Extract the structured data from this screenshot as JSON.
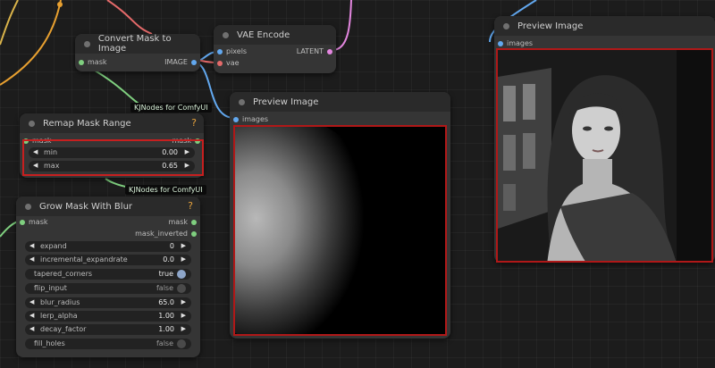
{
  "nodes": {
    "convert_mask": {
      "title": "Convert Mask to Image",
      "input": "mask",
      "output": "IMAGE"
    },
    "vae_encode": {
      "title": "VAE Encode",
      "inputs": [
        "pixels",
        "vae"
      ],
      "output": "LATENT"
    },
    "preview_mid": {
      "title": "Preview Image",
      "input": "images"
    },
    "preview_right": {
      "title": "Preview Image",
      "input": "images"
    },
    "remap_mask": {
      "title": "Remap Mask Range",
      "input": "mask",
      "output": "mask",
      "widgets": [
        {
          "label": "min",
          "value": "0.00"
        },
        {
          "label": "max",
          "value": "0.65"
        }
      ]
    },
    "grow_mask": {
      "title": "Grow Mask With Blur",
      "input": "mask",
      "outputs": [
        "mask",
        "mask_inverted"
      ],
      "widgets": [
        {
          "label": "expand",
          "value": "0"
        },
        {
          "label": "incremental_expandrate",
          "value": "0.0"
        },
        {
          "label": "tapered_corners",
          "value": "true"
        },
        {
          "label": "flip_input",
          "value": "false"
        },
        {
          "label": "blur_radius",
          "value": "65.0"
        },
        {
          "label": "lerp_alpha",
          "value": "1.00"
        },
        {
          "label": "decay_factor",
          "value": "1.00"
        },
        {
          "label": "fill_holes",
          "value": "false"
        }
      ]
    }
  },
  "tooltips": {
    "kjnodes_1": "KJNodes for ComfyUI",
    "kjnodes_2": "KJNodes for ComfyUI"
  },
  "icons": {
    "help": "?",
    "arrow_left": "◀",
    "arrow_right": "▶"
  },
  "colors": {
    "mask_wire": "#7fcf7f",
    "image_wire": "#62a8ef",
    "vae_wire": "#e46a6a",
    "latent_wire": "#e487e0",
    "highlight": "#c71f1f",
    "help": "#e6a23c"
  }
}
